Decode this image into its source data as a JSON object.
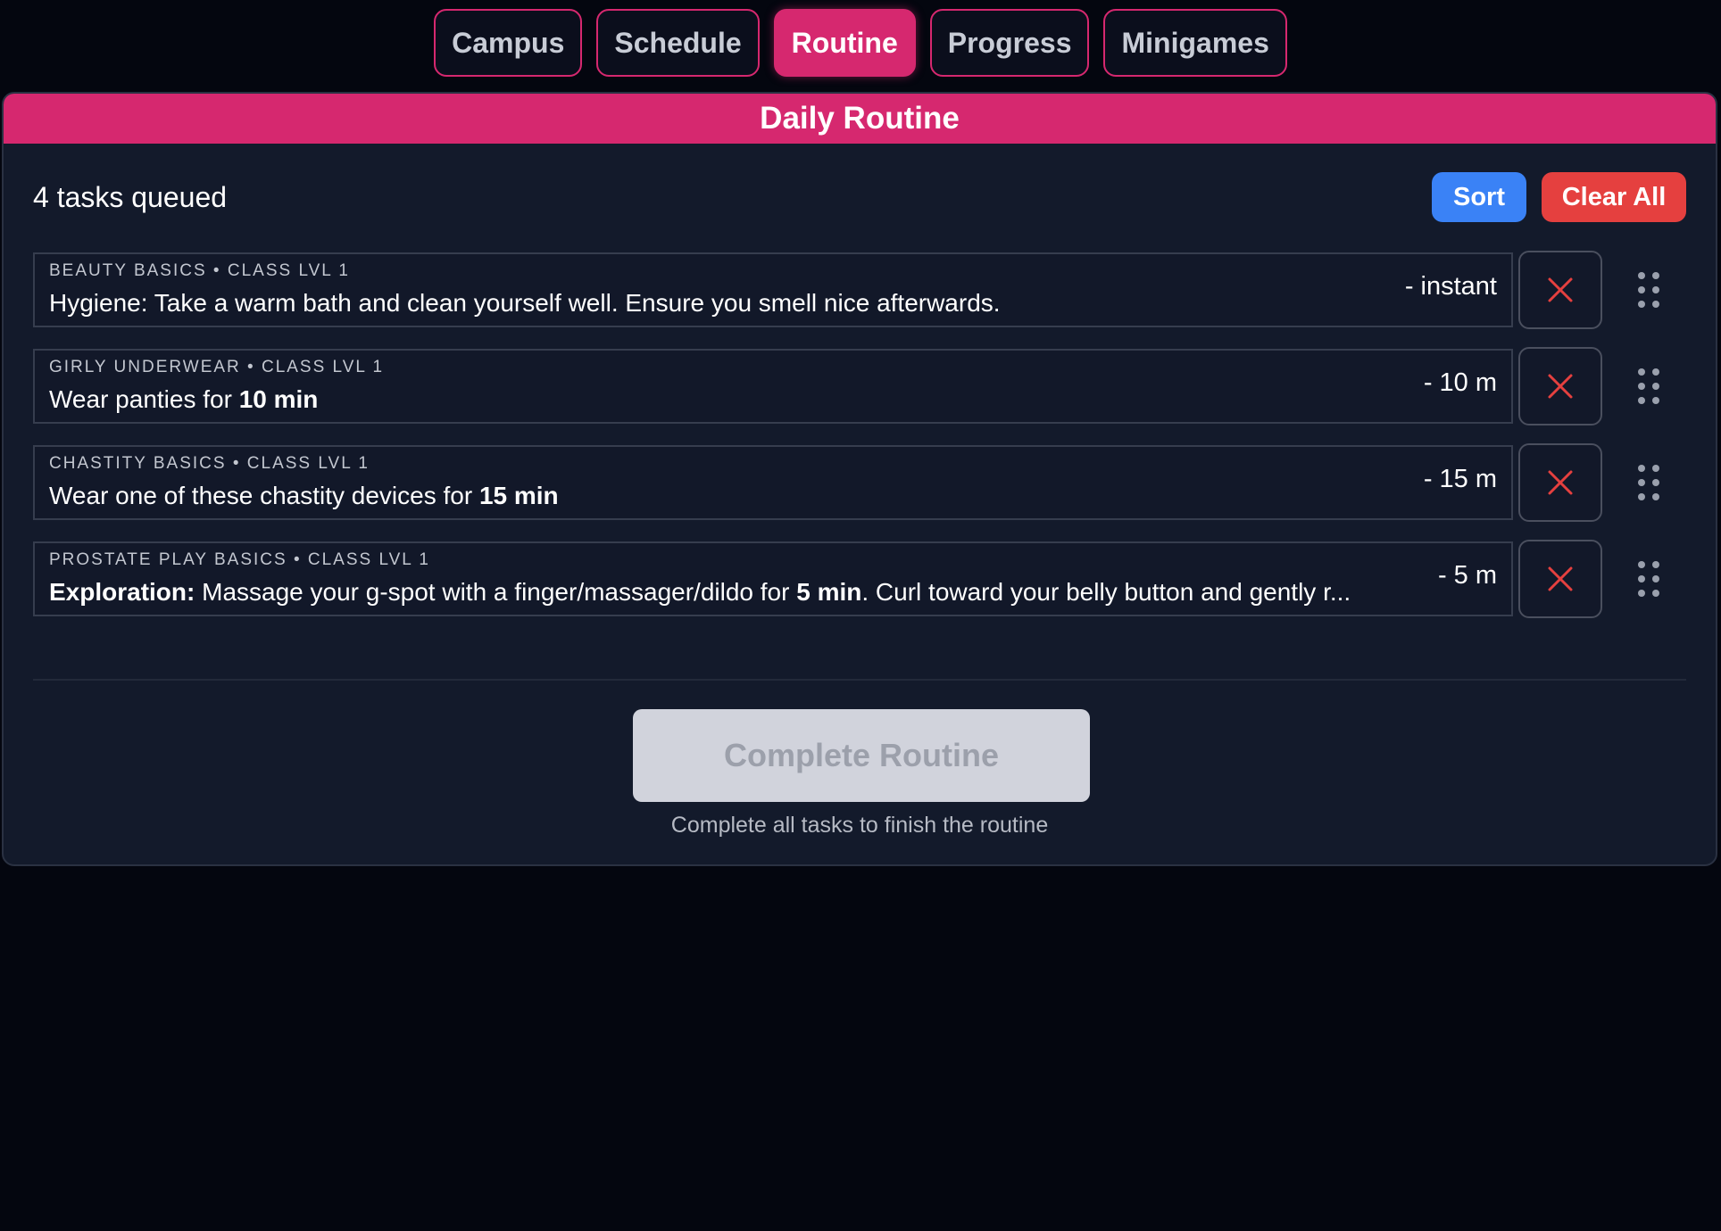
{
  "tabs": [
    {
      "label": "Campus",
      "active": false
    },
    {
      "label": "Schedule",
      "active": false
    },
    {
      "label": "Routine",
      "active": true
    },
    {
      "label": "Progress",
      "active": false
    },
    {
      "label": "Minigames",
      "active": false
    }
  ],
  "panel": {
    "title": "Daily Routine",
    "queue_count": "4 tasks queued",
    "sort_label": "Sort",
    "clear_label": "Clear All"
  },
  "tasks": [
    {
      "meta": "BEAUTY BASICS • CLASS LVL 1",
      "text_parts": [
        {
          "t": "Hygiene: Take a warm bath and clean yourself well. Ensure you smell nice afterwards.",
          "bold": false
        }
      ],
      "duration": "- instant"
    },
    {
      "meta": "GIRLY UNDERWEAR • CLASS LVL 1",
      "text_parts": [
        {
          "t": "Wear panties for ",
          "bold": false
        },
        {
          "t": "10 min",
          "bold": true
        }
      ],
      "duration": "- 10 m"
    },
    {
      "meta": "CHASTITY BASICS • CLASS LVL 1",
      "text_parts": [
        {
          "t": "Wear one of these chastity devices for ",
          "bold": false
        },
        {
          "t": "15 min",
          "bold": true
        }
      ],
      "duration": "- 15 m"
    },
    {
      "meta": "PROSTATE PLAY BASICS • CLASS LVL 1",
      "text_parts": [
        {
          "t": "Exploration:",
          "bold": true
        },
        {
          "t": " Massage your g-spot with a finger/massager/dildo for ",
          "bold": false
        },
        {
          "t": "5 min",
          "bold": true
        },
        {
          "t": ". Curl toward your belly button and gently r...",
          "bold": false
        }
      ],
      "duration": "- 5 m"
    }
  ],
  "footer": {
    "complete_label": "Complete Routine",
    "complete_hint": "Complete all tasks to finish the routine"
  },
  "icons": {
    "remove": "close-icon",
    "drag": "drag-handle-icon"
  },
  "colors": {
    "accent": "#d6286f",
    "sort": "#3a82f6",
    "clear": "#e5403f",
    "remove_x": "#e5403f"
  }
}
